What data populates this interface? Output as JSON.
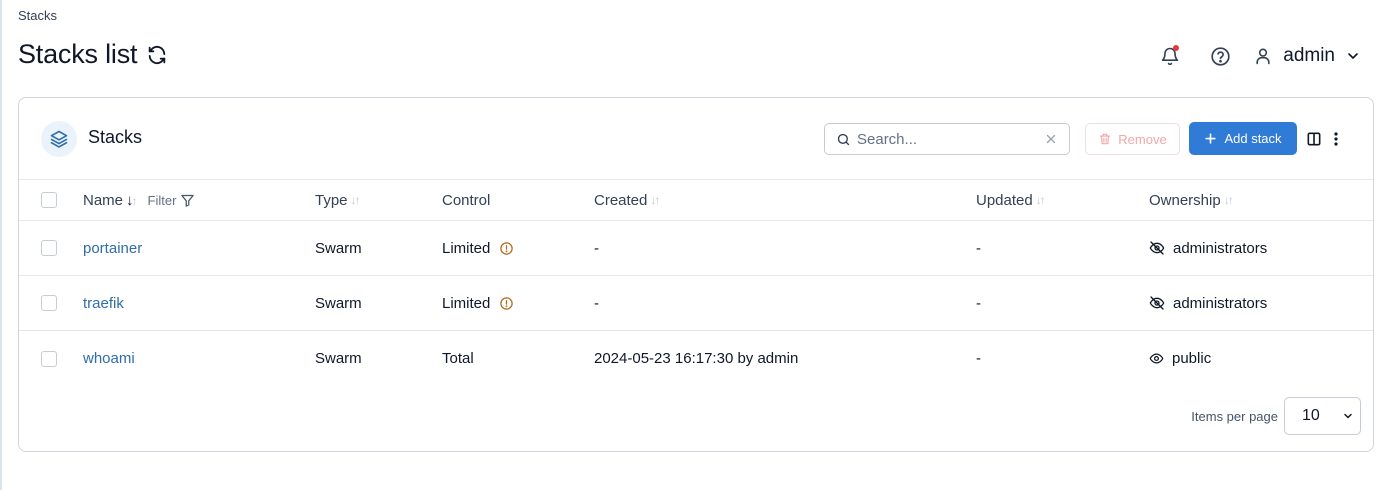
{
  "breadcrumb": "Stacks",
  "page": {
    "title": "Stacks list"
  },
  "user": {
    "name": "admin"
  },
  "card": {
    "title": "Stacks",
    "search_placeholder": "Search...",
    "remove_label": "Remove",
    "add_label": "Add stack"
  },
  "table": {
    "headers": {
      "name": "Name",
      "filter": "Filter",
      "type": "Type",
      "control": "Control",
      "created": "Created",
      "updated": "Updated",
      "ownership": "Ownership"
    },
    "rows": [
      {
        "name": "portainer",
        "type": "Swarm",
        "control": "Limited",
        "created": "-",
        "updated": "-",
        "ownership": "administrators"
      },
      {
        "name": "traefik",
        "type": "Swarm",
        "control": "Limited",
        "created": "-",
        "updated": "-",
        "ownership": "administrators"
      },
      {
        "name": "whoami",
        "type": "Swarm",
        "control": "Total",
        "created": "2024-05-23 16:17:30 by admin",
        "updated": "-",
        "ownership": "public"
      }
    ]
  },
  "pagination": {
    "label": "Items per page",
    "value": "10"
  },
  "colors": {
    "primary": "#2f7bd6",
    "link": "#2f6ea8",
    "warning": "#b06a1a",
    "danger_faded": "#f1a8a8"
  }
}
